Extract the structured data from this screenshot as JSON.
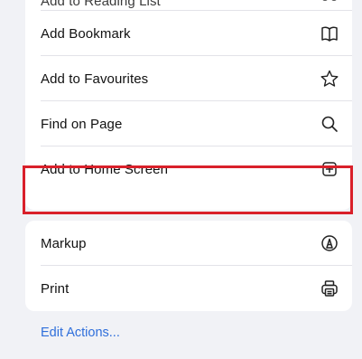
{
  "menu": {
    "group1": [
      {
        "label": "Add to Reading List",
        "icon": "glasses-icon"
      },
      {
        "label": "Add Bookmark",
        "icon": "book-icon"
      },
      {
        "label": "Add to Favourites",
        "icon": "star-icon"
      },
      {
        "label": "Find on Page",
        "icon": "search-icon"
      },
      {
        "label": "Add to Home Screen",
        "icon": "plus-square-icon"
      }
    ],
    "group2": [
      {
        "label": "Markup",
        "icon": "markup-icon"
      },
      {
        "label": "Print",
        "icon": "printer-icon"
      }
    ]
  },
  "footer": {
    "edit_actions_label": "Edit Actions..."
  },
  "colors": {
    "background": "#f1f2f6",
    "card": "#ffffff",
    "highlight": "#d9202a",
    "link": "#2f6fdb"
  }
}
